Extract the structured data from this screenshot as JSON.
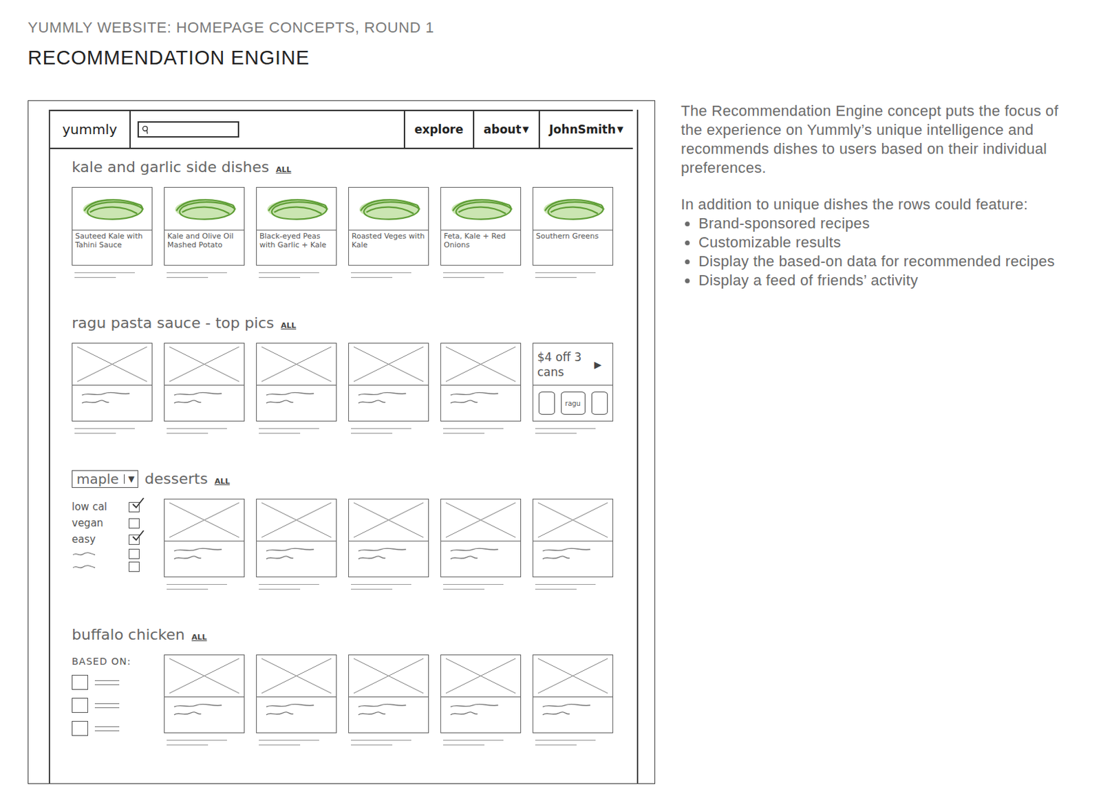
{
  "page": {
    "eyebrow": "YUMMLY WEBSITE: HOMEPAGE CONCEPTS, ROUND 1",
    "title": "RECOMMENDATION ENGINE"
  },
  "sketch": {
    "nav": {
      "logo": "yummly",
      "items": [
        {
          "label": "explore",
          "arrow": ""
        },
        {
          "label": "about",
          "arrow": "▼"
        },
        {
          "label": "JohnSmith",
          "arrow": "▼"
        }
      ]
    },
    "rows": [
      {
        "title": "kale and garlic side dishes",
        "link": "ALL",
        "cards": [
          {
            "kind": "photo",
            "caption": "Sauteed Kale with Tahini Sauce"
          },
          {
            "kind": "photo",
            "caption": "Kale and Olive Oil Mashed Potato"
          },
          {
            "kind": "photo",
            "caption": "Black-eyed Peas with Garlic + Kale"
          },
          {
            "kind": "photo",
            "caption": "Roasted Veges with Kale"
          },
          {
            "kind": "photo",
            "caption": "Feta, Kale + Red Onions"
          },
          {
            "kind": "photo",
            "caption": "Southern Greens"
          }
        ]
      },
      {
        "title": "ragu pasta sauce - top pics",
        "link": "ALL",
        "cards": [
          {
            "kind": "placeholder"
          },
          {
            "kind": "placeholder"
          },
          {
            "kind": "placeholder"
          },
          {
            "kind": "placeholder"
          },
          {
            "kind": "placeholder"
          },
          {
            "kind": "ad",
            "offer": "$4 off 3 cans",
            "arrow": "▶",
            "brand": "ragu"
          }
        ]
      },
      {
        "title": "desserts",
        "link": "ALL",
        "dropdown": {
          "value": "maple",
          "arrow": "▼"
        },
        "filters": [
          {
            "kind": "label",
            "label": "low cal",
            "checked": true
          },
          {
            "kind": "label",
            "label": "vegan",
            "checked": false
          },
          {
            "kind": "label",
            "label": "easy",
            "checked": true
          },
          {
            "kind": "scribble",
            "label": "",
            "checked": false
          },
          {
            "kind": "scribble",
            "label": "",
            "checked": false
          }
        ],
        "cards": [
          {
            "kind": "placeholder"
          },
          {
            "kind": "placeholder"
          },
          {
            "kind": "placeholder"
          },
          {
            "kind": "placeholder"
          },
          {
            "kind": "placeholder"
          }
        ]
      },
      {
        "title": "buffalo chicken",
        "link": "ALL",
        "based_on": {
          "label": "BASED ON:",
          "items": [
            {
              "checked": false
            },
            {
              "checked": false
            },
            {
              "checked": false
            }
          ]
        },
        "cards": [
          {
            "kind": "placeholder"
          },
          {
            "kind": "placeholder"
          },
          {
            "kind": "placeholder"
          },
          {
            "kind": "placeholder"
          },
          {
            "kind": "placeholder"
          }
        ]
      }
    ]
  },
  "description": {
    "intro": "The Recommendation Engine concept puts the focus of the experience on Yummly’s unique intelligence and recommends dishes to users based on their individual preferences.",
    "lead": "In addition to unique dishes the rows could feature:",
    "bullets": [
      "Brand-sponsored recipes",
      "Customizable results",
      "Display the based-on data for recommended recipes",
      "Display a feed of friends’ activity"
    ]
  }
}
